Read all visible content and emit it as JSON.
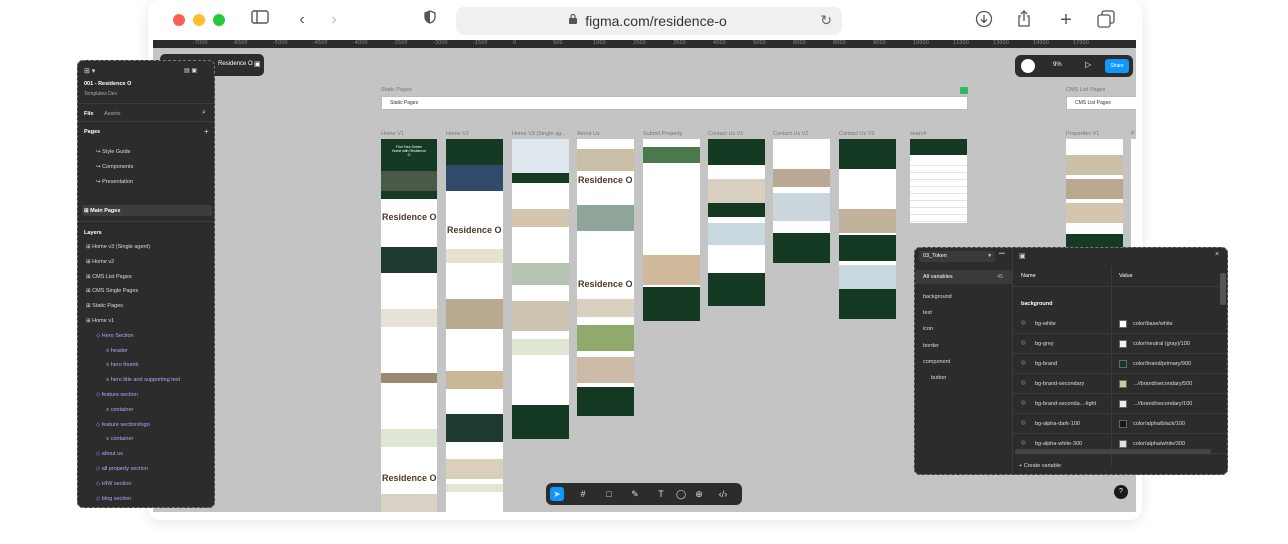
{
  "browser": {
    "url": "figma.com/residence-o",
    "traffic_colors": [
      "#ff5f57",
      "#febc2e",
      "#28c840"
    ]
  },
  "ruler": [
    "-7000",
    "-6500",
    "-5000",
    "-4500",
    "-4000",
    "-3500",
    "-3000",
    "-1500",
    "0",
    "500",
    "1000",
    "2500",
    "3500",
    "4000",
    "5000",
    "6000",
    "8000",
    "9000",
    "10000",
    "11000",
    "13000",
    "14000",
    "17000"
  ],
  "file_pill": {
    "title": "Residence O"
  },
  "left_panel": {
    "project": "001 - Residence O",
    "team": "Templates Dev",
    "tabs": [
      "File",
      "Assets"
    ],
    "pages_label": "Pages",
    "pages": [
      "Style Guide",
      "Components",
      "Presentation"
    ],
    "main_pages": "Main Pages",
    "layers_label": "Layers",
    "layers": [
      {
        "label": "Home v3 (Single agent)",
        "indent": 0,
        "purple": false
      },
      {
        "label": "Home v2",
        "indent": 0,
        "purple": false
      },
      {
        "label": "CMS List Pages",
        "indent": 0,
        "purple": false
      },
      {
        "label": "CMS Single Pages",
        "indent": 0,
        "purple": false
      },
      {
        "label": "Static Pages",
        "indent": 0,
        "purple": false
      },
      {
        "label": "Home v1",
        "indent": 0,
        "purple": false
      },
      {
        "label": "Hero Section",
        "indent": 1,
        "purple": true
      },
      {
        "label": "header",
        "indent": 2,
        "purple": true
      },
      {
        "label": "hero thumb",
        "indent": 2,
        "purple": true
      },
      {
        "label": "hero title and supporting text",
        "indent": 2,
        "purple": true
      },
      {
        "label": "feature section",
        "indent": 1,
        "purple": true
      },
      {
        "label": "container",
        "indent": 2,
        "purple": true
      },
      {
        "label": "feature section/logo",
        "indent": 1,
        "purple": true
      },
      {
        "label": "container",
        "indent": 2,
        "purple": true
      },
      {
        "label": "about us",
        "indent": 1,
        "purple": true
      },
      {
        "label": "all property section",
        "indent": 1,
        "purple": true
      },
      {
        "label": "HIW section",
        "indent": 1,
        "purple": true
      },
      {
        "label": "blog section",
        "indent": 1,
        "purple": true
      }
    ]
  },
  "toolbar_right": {
    "zoom": "9%",
    "share": "Share"
  },
  "canvas": {
    "static_pages_label": "Static Pages",
    "static_pages_bar": "Static Pages",
    "cms_label": "CMS List Pages",
    "cms_bar": "CMS List Pages",
    "columns": [
      {
        "label": "Home V1"
      },
      {
        "label": "Home V2"
      },
      {
        "label": "Home V3 (Single ag..."
      },
      {
        "label": "About Us"
      },
      {
        "label": "Submit Property"
      },
      {
        "label": "Contact Us V1"
      },
      {
        "label": "Contact Us V2"
      },
      {
        "label": "Contact Us V3"
      },
      {
        "label": "search"
      },
      {
        "label": "Properties V1"
      },
      {
        "label": "P"
      }
    ],
    "brand_text": "Residence O",
    "hero_headline": "Find Your Dream Home with Residence O"
  },
  "variables_panel": {
    "collection": "03_Token",
    "all_variables": "All variables",
    "count": "45",
    "groups": [
      "background",
      "text",
      "icon",
      "border",
      "component",
      "button"
    ],
    "col_name": "Name",
    "col_value": "Value",
    "section": "background",
    "rows": [
      {
        "name": "bg-white",
        "value": "color/base/white",
        "swatch": "#ffffff"
      },
      {
        "name": "bg-grey",
        "value": "color/neutral (gray)/100",
        "swatch": "#f2f2f2"
      },
      {
        "name": "bg-brand",
        "value": "color/brand/primary/900",
        "swatch": "#143a24"
      },
      {
        "name": "bg-brand-secondary",
        "value": "...//brand/secondary/500",
        "swatch": "#c6ccaa"
      },
      {
        "name": "bg-brand-seconda...-light",
        "value": "...//brand/secondary/100",
        "swatch": "#eef0e4"
      },
      {
        "name": "bg-alpha-dark-100",
        "value": "color/alpha/black/100",
        "swatch": "#1a1a1a"
      },
      {
        "name": "bg-alpha-white-300",
        "value": "color/alpha/white/300",
        "swatch": "#e0e0e0"
      }
    ],
    "create": "+ Create variable"
  },
  "colors": {
    "dark_green": "#143a24",
    "figma_dark": "#2c2c2c",
    "accent": "#0d99ff",
    "canvas": "#c4c4c4"
  }
}
